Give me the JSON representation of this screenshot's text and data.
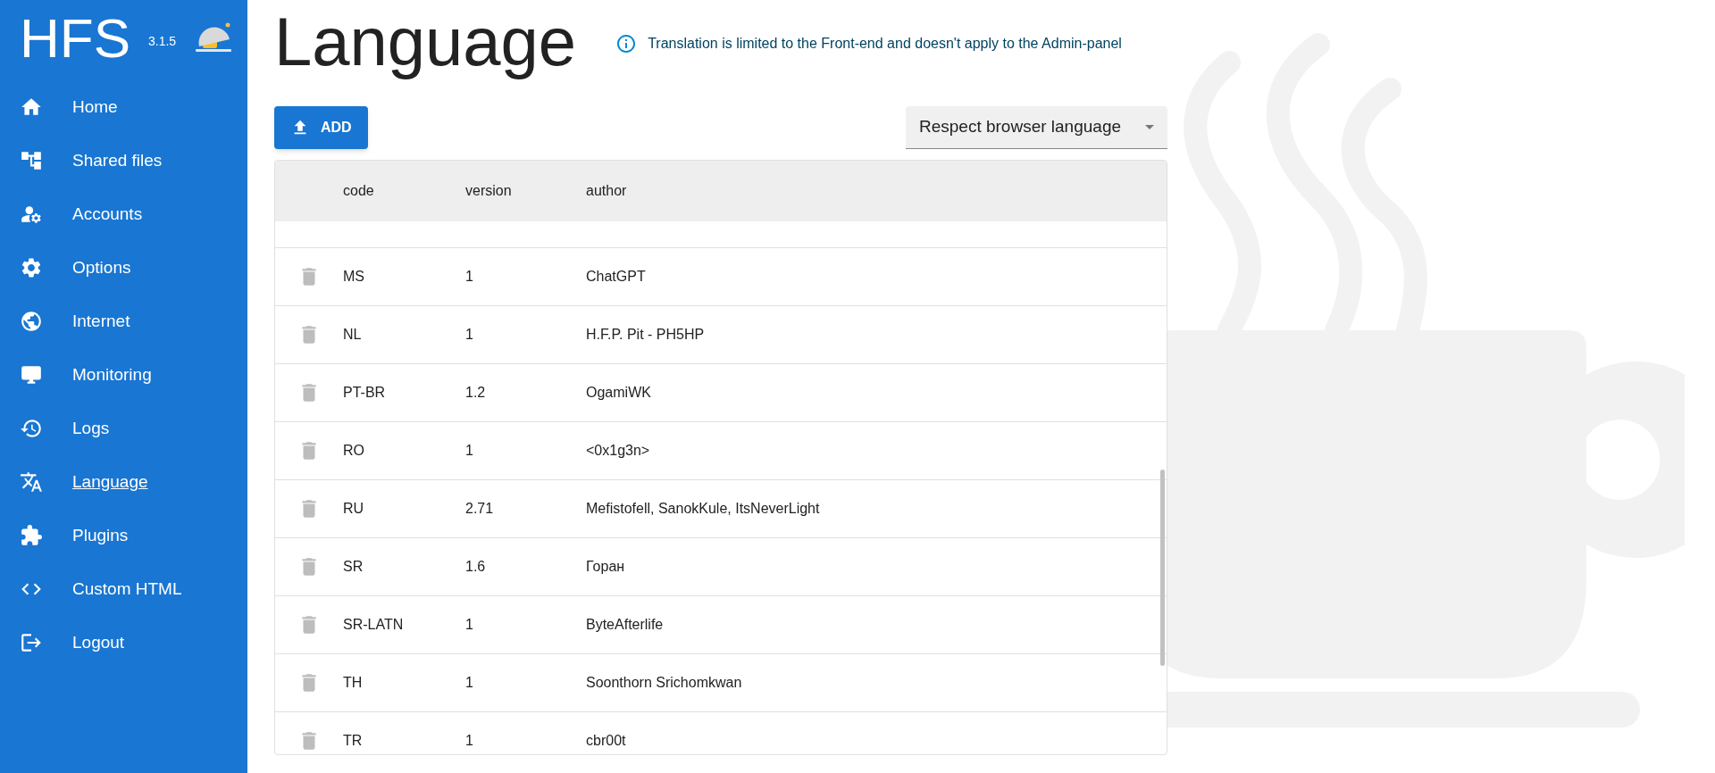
{
  "app": {
    "logo": "HFS",
    "version": "3.1.5"
  },
  "sidebar": {
    "items": [
      {
        "kind": "home",
        "label": "Home",
        "selected": false
      },
      {
        "kind": "files",
        "label": "Shared files",
        "selected": false
      },
      {
        "kind": "accounts",
        "label": "Accounts",
        "selected": false
      },
      {
        "kind": "options",
        "label": "Options",
        "selected": false
      },
      {
        "kind": "internet",
        "label": "Internet",
        "selected": false
      },
      {
        "kind": "monitoring",
        "label": "Monitoring",
        "selected": false
      },
      {
        "kind": "logs",
        "label": "Logs",
        "selected": false
      },
      {
        "kind": "language",
        "label": "Language",
        "selected": true
      },
      {
        "kind": "plugins",
        "label": "Plugins",
        "selected": false
      },
      {
        "kind": "html",
        "label": "Custom HTML",
        "selected": false
      },
      {
        "kind": "logout",
        "label": "Logout",
        "selected": false
      }
    ]
  },
  "page": {
    "title": "Language",
    "info": "Translation is limited to the Front-end and doesn't apply to the Admin-panel"
  },
  "toolbar": {
    "add_button": "ADD",
    "language_select": "Respect browser language"
  },
  "table": {
    "columns": [
      "code",
      "version",
      "author"
    ],
    "rows": [
      {
        "code": "MS",
        "version": "1",
        "author": "ChatGPT"
      },
      {
        "code": "NL",
        "version": "1",
        "author": "H.F.P. Pit - PH5HP"
      },
      {
        "code": "PT-BR",
        "version": "1.2",
        "author": "OgamiWK"
      },
      {
        "code": "RO",
        "version": "1",
        "author": "<0x1g3n>"
      },
      {
        "code": "RU",
        "version": "2.71",
        "author": "Mefistofell, SanokKule, ItsNeverLight"
      },
      {
        "code": "SR",
        "version": "1.6",
        "author": "Горан"
      },
      {
        "code": "SR-LATN",
        "version": "1",
        "author": "ByteAfterlife"
      },
      {
        "code": "TH",
        "version": "1",
        "author": "Soonthorn Srichomkwan"
      },
      {
        "code": "TR",
        "version": "1",
        "author": "cbr00t"
      }
    ]
  }
}
